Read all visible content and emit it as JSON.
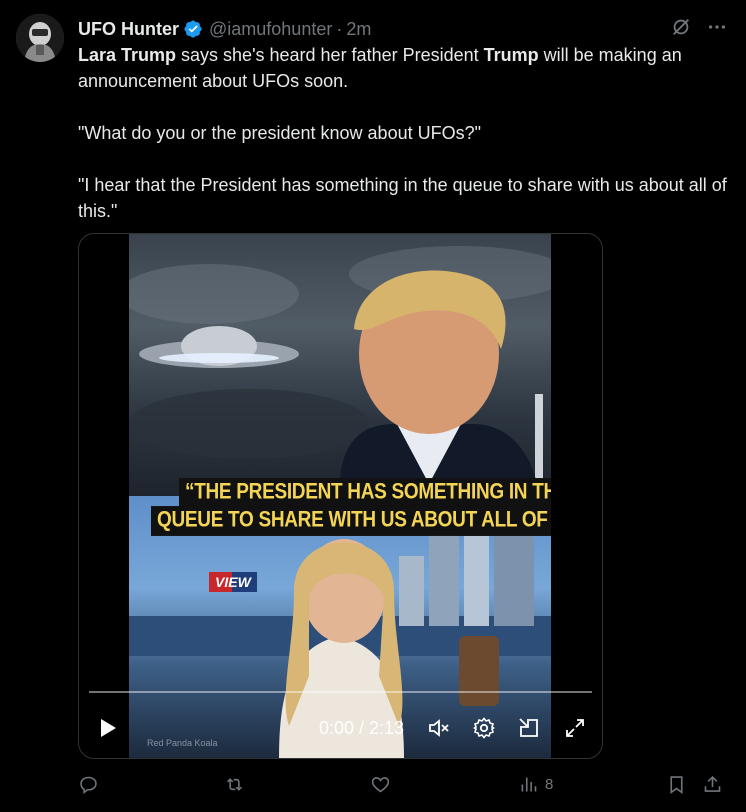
{
  "tweet": {
    "display_name": "UFO Hunter",
    "handle": "@iamufohunter",
    "separator": "·",
    "time": "2m",
    "text": {
      "p1_bold1": "Lara Trump",
      "p1_mid": " says she's heard her father President ",
      "p1_bold2": "Trump",
      "p1_end": " will be making an announcement about UFOs soon.",
      "p2": "\"What do you or the president know about UFOs?\"",
      "p3": "\"I hear that the President has something in the queue to share with us about all of this.\""
    },
    "icons": {
      "verified": "verified-badge-icon",
      "grok": "grok-icon",
      "more": "more-icon"
    }
  },
  "video": {
    "caption_line1": "“THE PRESIDENT HAS SOMETHING IN THE",
    "caption_line2": "QUEUE TO SHARE WITH US ABOUT ALL OF THIS”",
    "brand_logo": "VIEW",
    "watermark": "Red Panda Koala",
    "timecode": "0:00 / 2:13",
    "progress": 0,
    "controls": [
      "play-icon",
      "mute-icon",
      "settings-icon",
      "pip-icon",
      "fullscreen-icon"
    ]
  },
  "actions": {
    "reply_count": "",
    "repost_count": "",
    "like_count": "",
    "views_count": "8",
    "icons": [
      "reply-icon",
      "repost-icon",
      "like-icon",
      "views-icon",
      "bookmark-icon",
      "share-icon"
    ]
  },
  "colors": {
    "background": "#000000",
    "text": "#e7e9ea",
    "muted": "#71767b",
    "verified": "#1d9bf0",
    "caption": "#f3d455"
  }
}
